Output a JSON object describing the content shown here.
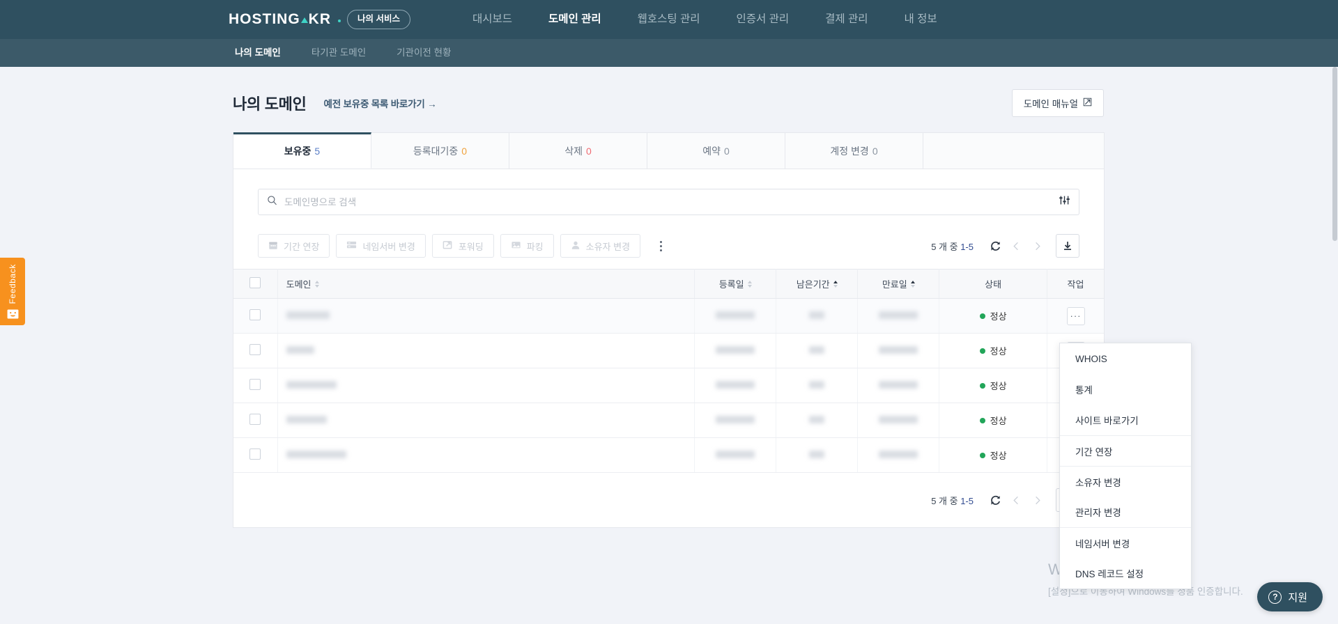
{
  "header": {
    "logo_text": "HOSTING",
    "logo_text2": "KR",
    "my_service_label": "나의 서비스",
    "nav": [
      {
        "label": "대시보드",
        "active": false
      },
      {
        "label": "도메인 관리",
        "active": true
      },
      {
        "label": "웹호스팅 관리",
        "active": false
      },
      {
        "label": "인증서 관리",
        "active": false
      },
      {
        "label": "결제 관리",
        "active": false
      },
      {
        "label": "내 정보",
        "active": false
      }
    ]
  },
  "subnav": {
    "items": [
      {
        "label": "나의 도메인",
        "active": true
      },
      {
        "label": "타기관 도메인",
        "active": false
      },
      {
        "label": "기관이전 현황",
        "active": false
      }
    ]
  },
  "page": {
    "title": "나의 도메인",
    "legacy_link": "예전 보유중 목록 바로가기 →",
    "manual_button": "도메인 매뉴얼",
    "manual_icon": "external-link-icon"
  },
  "tabs": [
    {
      "label": "보유중",
      "count": "5",
      "count_color": "blue",
      "active": true
    },
    {
      "label": "등록대기중",
      "count": "0",
      "count_color": "orange",
      "active": false
    },
    {
      "label": "삭제",
      "count": "0",
      "count_color": "red",
      "active": false
    },
    {
      "label": "예약",
      "count": "0",
      "count_color": "gray",
      "active": false
    },
    {
      "label": "계정 변경",
      "count": "0",
      "count_color": "gray",
      "active": false
    }
  ],
  "search": {
    "placeholder": "도메인명으로 검색",
    "value": "",
    "search_icon": "search-icon",
    "filter_icon": "filter-sliders-icon"
  },
  "toolbar": {
    "buttons": [
      {
        "label": "기간 연장",
        "icon": "calendar-icon",
        "disabled": true
      },
      {
        "label": "네임서버 변경",
        "icon": "server-icon",
        "disabled": true
      },
      {
        "label": "포워딩",
        "icon": "forward-icon",
        "disabled": true
      },
      {
        "label": "파킹",
        "icon": "image-icon",
        "disabled": true
      },
      {
        "label": "소유자 변경",
        "icon": "user-icon",
        "disabled": true
      }
    ],
    "more_icon": "kebab-vertical-icon",
    "count_prefix": "5 개 중 ",
    "count_range": "1-5",
    "refresh_icon": "refresh-icon",
    "prev_icon": "chevron-left-icon",
    "next_icon": "chevron-right-icon",
    "download_icon": "download-icon"
  },
  "table": {
    "columns": [
      {
        "label": "",
        "key": "checkbox"
      },
      {
        "label": "도메인",
        "key": "domain",
        "sortable": true,
        "sort": "none"
      },
      {
        "label": "등록일",
        "key": "reg_date",
        "sortable": true,
        "sort": "none"
      },
      {
        "label": "남은기간",
        "key": "remaining",
        "sortable": true,
        "sort": "asc"
      },
      {
        "label": "만료일",
        "key": "expiry",
        "sortable": true,
        "sort": "asc"
      },
      {
        "label": "상태",
        "key": "status",
        "sortable": false
      },
      {
        "label": "작업",
        "key": "action",
        "sortable": false
      }
    ],
    "rows": [
      {
        "domain": "redacted",
        "domain_w": 62,
        "reg_date": "redacted",
        "reg_w": 56,
        "remaining": "redacted",
        "rem_w": 22,
        "expiry": "redacted",
        "exp_w": 56,
        "status": "정상",
        "action_icon": "kebab-horizontal-icon"
      },
      {
        "domain": "redacted",
        "domain_w": 40,
        "reg_date": "redacted",
        "reg_w": 56,
        "remaining": "redacted",
        "rem_w": 22,
        "expiry": "redacted",
        "exp_w": 56,
        "status": "정상",
        "action_icon": "kebab-horizontal-icon"
      },
      {
        "domain": "redacted",
        "domain_w": 72,
        "reg_date": "redacted",
        "reg_w": 56,
        "remaining": "redacted",
        "rem_w": 22,
        "expiry": "redacted",
        "exp_w": 56,
        "status": "정상",
        "action_icon": "kebab-horizontal-icon"
      },
      {
        "domain": "redacted",
        "domain_w": 58,
        "reg_date": "redacted",
        "reg_w": 56,
        "remaining": "redacted",
        "rem_w": 22,
        "expiry": "redacted",
        "exp_w": 56,
        "status": "정상",
        "action_icon": "kebab-horizontal-icon"
      },
      {
        "domain": "redacted",
        "domain_w": 86,
        "reg_date": "redacted",
        "reg_w": 56,
        "remaining": "redacted",
        "rem_w": 22,
        "expiry": "redacted",
        "exp_w": 56,
        "status": "정상",
        "action_icon": "kebab-horizontal-icon"
      }
    ]
  },
  "footer": {
    "count_prefix": "5 개 중 ",
    "count_range": "1-5",
    "refresh_icon": "refresh-icon",
    "prev_icon": "chevron-left-icon",
    "next_icon": "chevron-right-icon",
    "download_icon": "download-icon"
  },
  "context_menu": {
    "items": [
      {
        "label": "WHOIS",
        "divider_after": false
      },
      {
        "label": "통계",
        "divider_after": false
      },
      {
        "label": "사이트 바로가기",
        "divider_after": true
      },
      {
        "label": "기간 연장",
        "divider_after": true
      },
      {
        "label": "소유자 변경",
        "divider_after": false
      },
      {
        "label": "관리자 변경",
        "divider_after": true
      },
      {
        "label": "네임서버 변경",
        "divider_after": false
      },
      {
        "label": "DNS 레코드 설정",
        "divider_after": false
      }
    ]
  },
  "feedback": {
    "label": "Feedback",
    "icon": "smiley-envelope-icon",
    "color": "#f7911e"
  },
  "watermark": {
    "line1": "Windows 정품 인증",
    "line2": "[설정]으로 이동하여 Windows를 정품 인증합니다."
  },
  "support": {
    "label": "지원",
    "icon": "question-circle-icon"
  },
  "colors": {
    "header_bg": "#2f5060",
    "subnav_bg": "#3c5a69",
    "accent_teal": "#3fd3c6",
    "page_bg": "#f1f3f8",
    "status_green": "#22a559",
    "feedback_orange": "#f7911e"
  }
}
